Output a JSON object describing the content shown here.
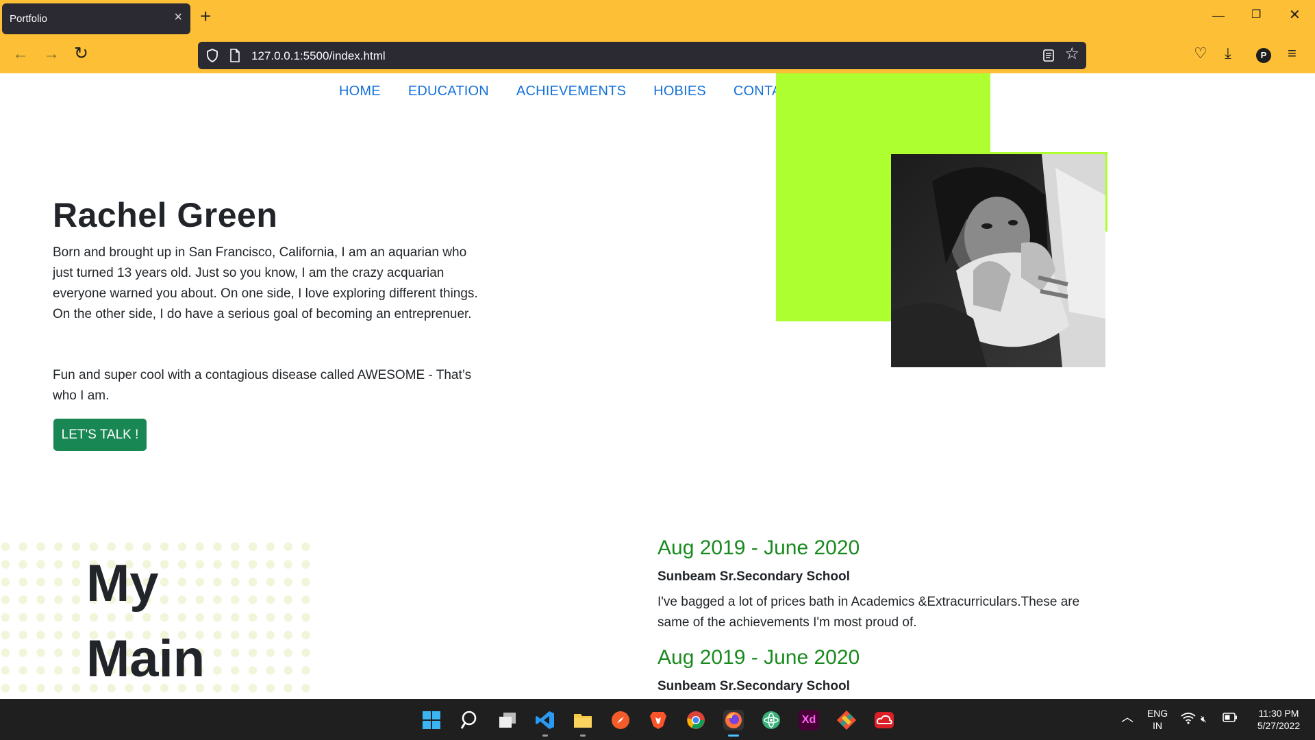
{
  "browser": {
    "tab_title": "Portfolio",
    "url": "127.0.0.1:5500/index.html",
    "profile_initial": "P"
  },
  "site": {
    "nav": [
      "HOME",
      "EDUCATION",
      "ACHIEVEMENTS",
      "HOBIES",
      "CONTACT"
    ],
    "hero": {
      "name": "Rachel Green",
      "bio": "Born and brought up in San Francisco, California, I am an aquarian who just turned 13 years old. Just so you know, I am the crazy acquarian everyone warned you about. On one side, I love exploring different things. On the other side, I do have a serious goal of becoming an entreprenuer.",
      "bio2": "Fun and super cool with a contagious disease called AWESOME - That’s who I am.",
      "cta": "LET'S TALK !"
    },
    "section_title": [
      "My",
      "Main"
    ],
    "education": [
      {
        "date": "Aug 2019 - June 2020",
        "school": "Sunbeam Sr.Secondary School",
        "desc": "I've bagged a lot of prices bath in Academics &Extracurriculars.These are same of the achievements I'm most proud of."
      },
      {
        "date": "Aug 2019 - June 2020",
        "school": "Sunbeam Sr.Secondary School"
      }
    ],
    "colors": {
      "accent": "#adff2f",
      "nav_link": "#1370d8",
      "button": "#198754",
      "date": "#198a1f"
    }
  },
  "taskbar": {
    "language": [
      "ENG",
      "IN"
    ],
    "time": "11:30 PM",
    "date": "5/27/2022",
    "apps": [
      "windows-start-icon",
      "search-icon",
      "task-view-icon",
      "vscode-icon",
      "file-explorer-icon",
      "compass-icon",
      "brave-icon",
      "chrome-icon",
      "firefox-icon",
      "atom-icon",
      "adobe-xd-icon",
      "git-icon",
      "creative-cloud-icon"
    ]
  }
}
